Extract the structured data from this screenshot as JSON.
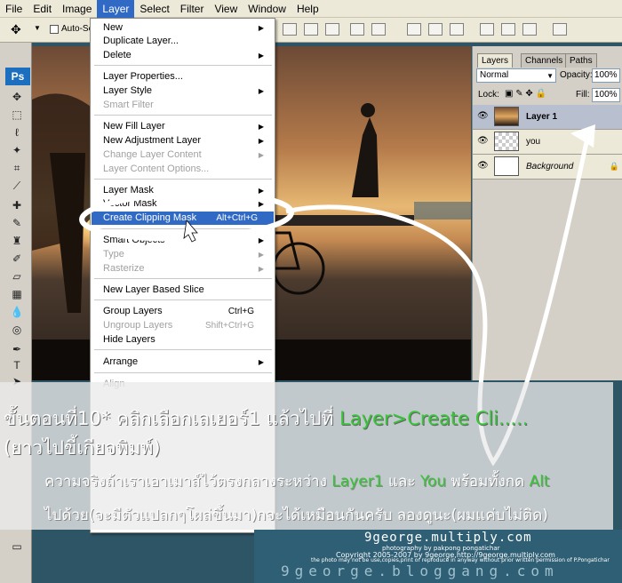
{
  "menubar": [
    "File",
    "Edit",
    "Image",
    "Layer",
    "Select",
    "Filter",
    "View",
    "Window",
    "Help"
  ],
  "options_bar": {
    "auto_select": "Auto-Se"
  },
  "toolbox": {
    "logo": "Ps"
  },
  "layers_panel": {
    "tabs": [
      "Layers",
      "Channels",
      "Paths"
    ],
    "blend_mode": "Normal",
    "opacity_label": "Opacity:",
    "opacity": "100%",
    "lock_label": "Lock:",
    "fill_label": "Fill:",
    "fill": "100%",
    "layers": [
      "Layer 1",
      "you",
      "Background"
    ]
  },
  "layer_menu": {
    "new": "New",
    "duplicate": "Duplicate Layer...",
    "delete": "Delete",
    "properties": "Layer Properties...",
    "style": "Layer Style",
    "smart_filter": "Smart Filter",
    "new_fill": "New Fill Layer",
    "new_adjustment": "New Adjustment Layer",
    "change_content": "Change Layer Content",
    "content_options": "Layer Content Options...",
    "layer_mask": "Layer Mask",
    "vector_mask": "Vector Mask",
    "clipping_mask": "Create Clipping Mask",
    "clipping_shortcut": "Alt+Ctrl+G",
    "smart_objects": "Smart Objects",
    "type": "Type",
    "rasterize": "Rasterize",
    "based_slice": "New Layer Based Slice",
    "group": "Group Layers",
    "group_shortcut": "Ctrl+G",
    "ungroup": "Ungroup Layers",
    "ungroup_shortcut": "Shift+Ctrl+G",
    "hide": "Hide Layers",
    "arrange": "Arrange",
    "align": "Align"
  },
  "annotation": {
    "step_prefix": "ขั้นตอนที่10* คลิกเลือกเลเยอร์1 แล้วไปที่ ",
    "step_menu": "Layer>Create Cli.....",
    "step_line2": "(ยาวไปขี้เกียจพิมพ์)",
    "note1_a": "ความจริงถ้าเราเอาเมาส์ไว้ตรงกลางระหว่าง ",
    "note1_b": "Layer1",
    "note1_c": " และ ",
    "note1_d": "You",
    "note1_e": " พร้อมทั้งกด ",
    "note1_f": "Alt",
    "note2": "ไปด้วย(จะมีตัวแปลกๆโผล่ขึ้นมา)กจะได้เหมือนกันครับ ลองดูนะ(ผมแค่บไม่ติด)"
  },
  "watermark": {
    "site1": "9george.multiply.com",
    "credit": "photography by pakpong pongatichar",
    "copyright": "Copyright 2005-2007 by 9george,http://9george.multiply.com",
    "notice": "the photo may not be use,copies,print or reproduce in anyway without prior written permission of P.Pongatichar",
    "site2": "9george.bloggang.com"
  },
  "colors": {
    "menu_highlight": "#316ac5",
    "annotation_green": "#37c637"
  }
}
